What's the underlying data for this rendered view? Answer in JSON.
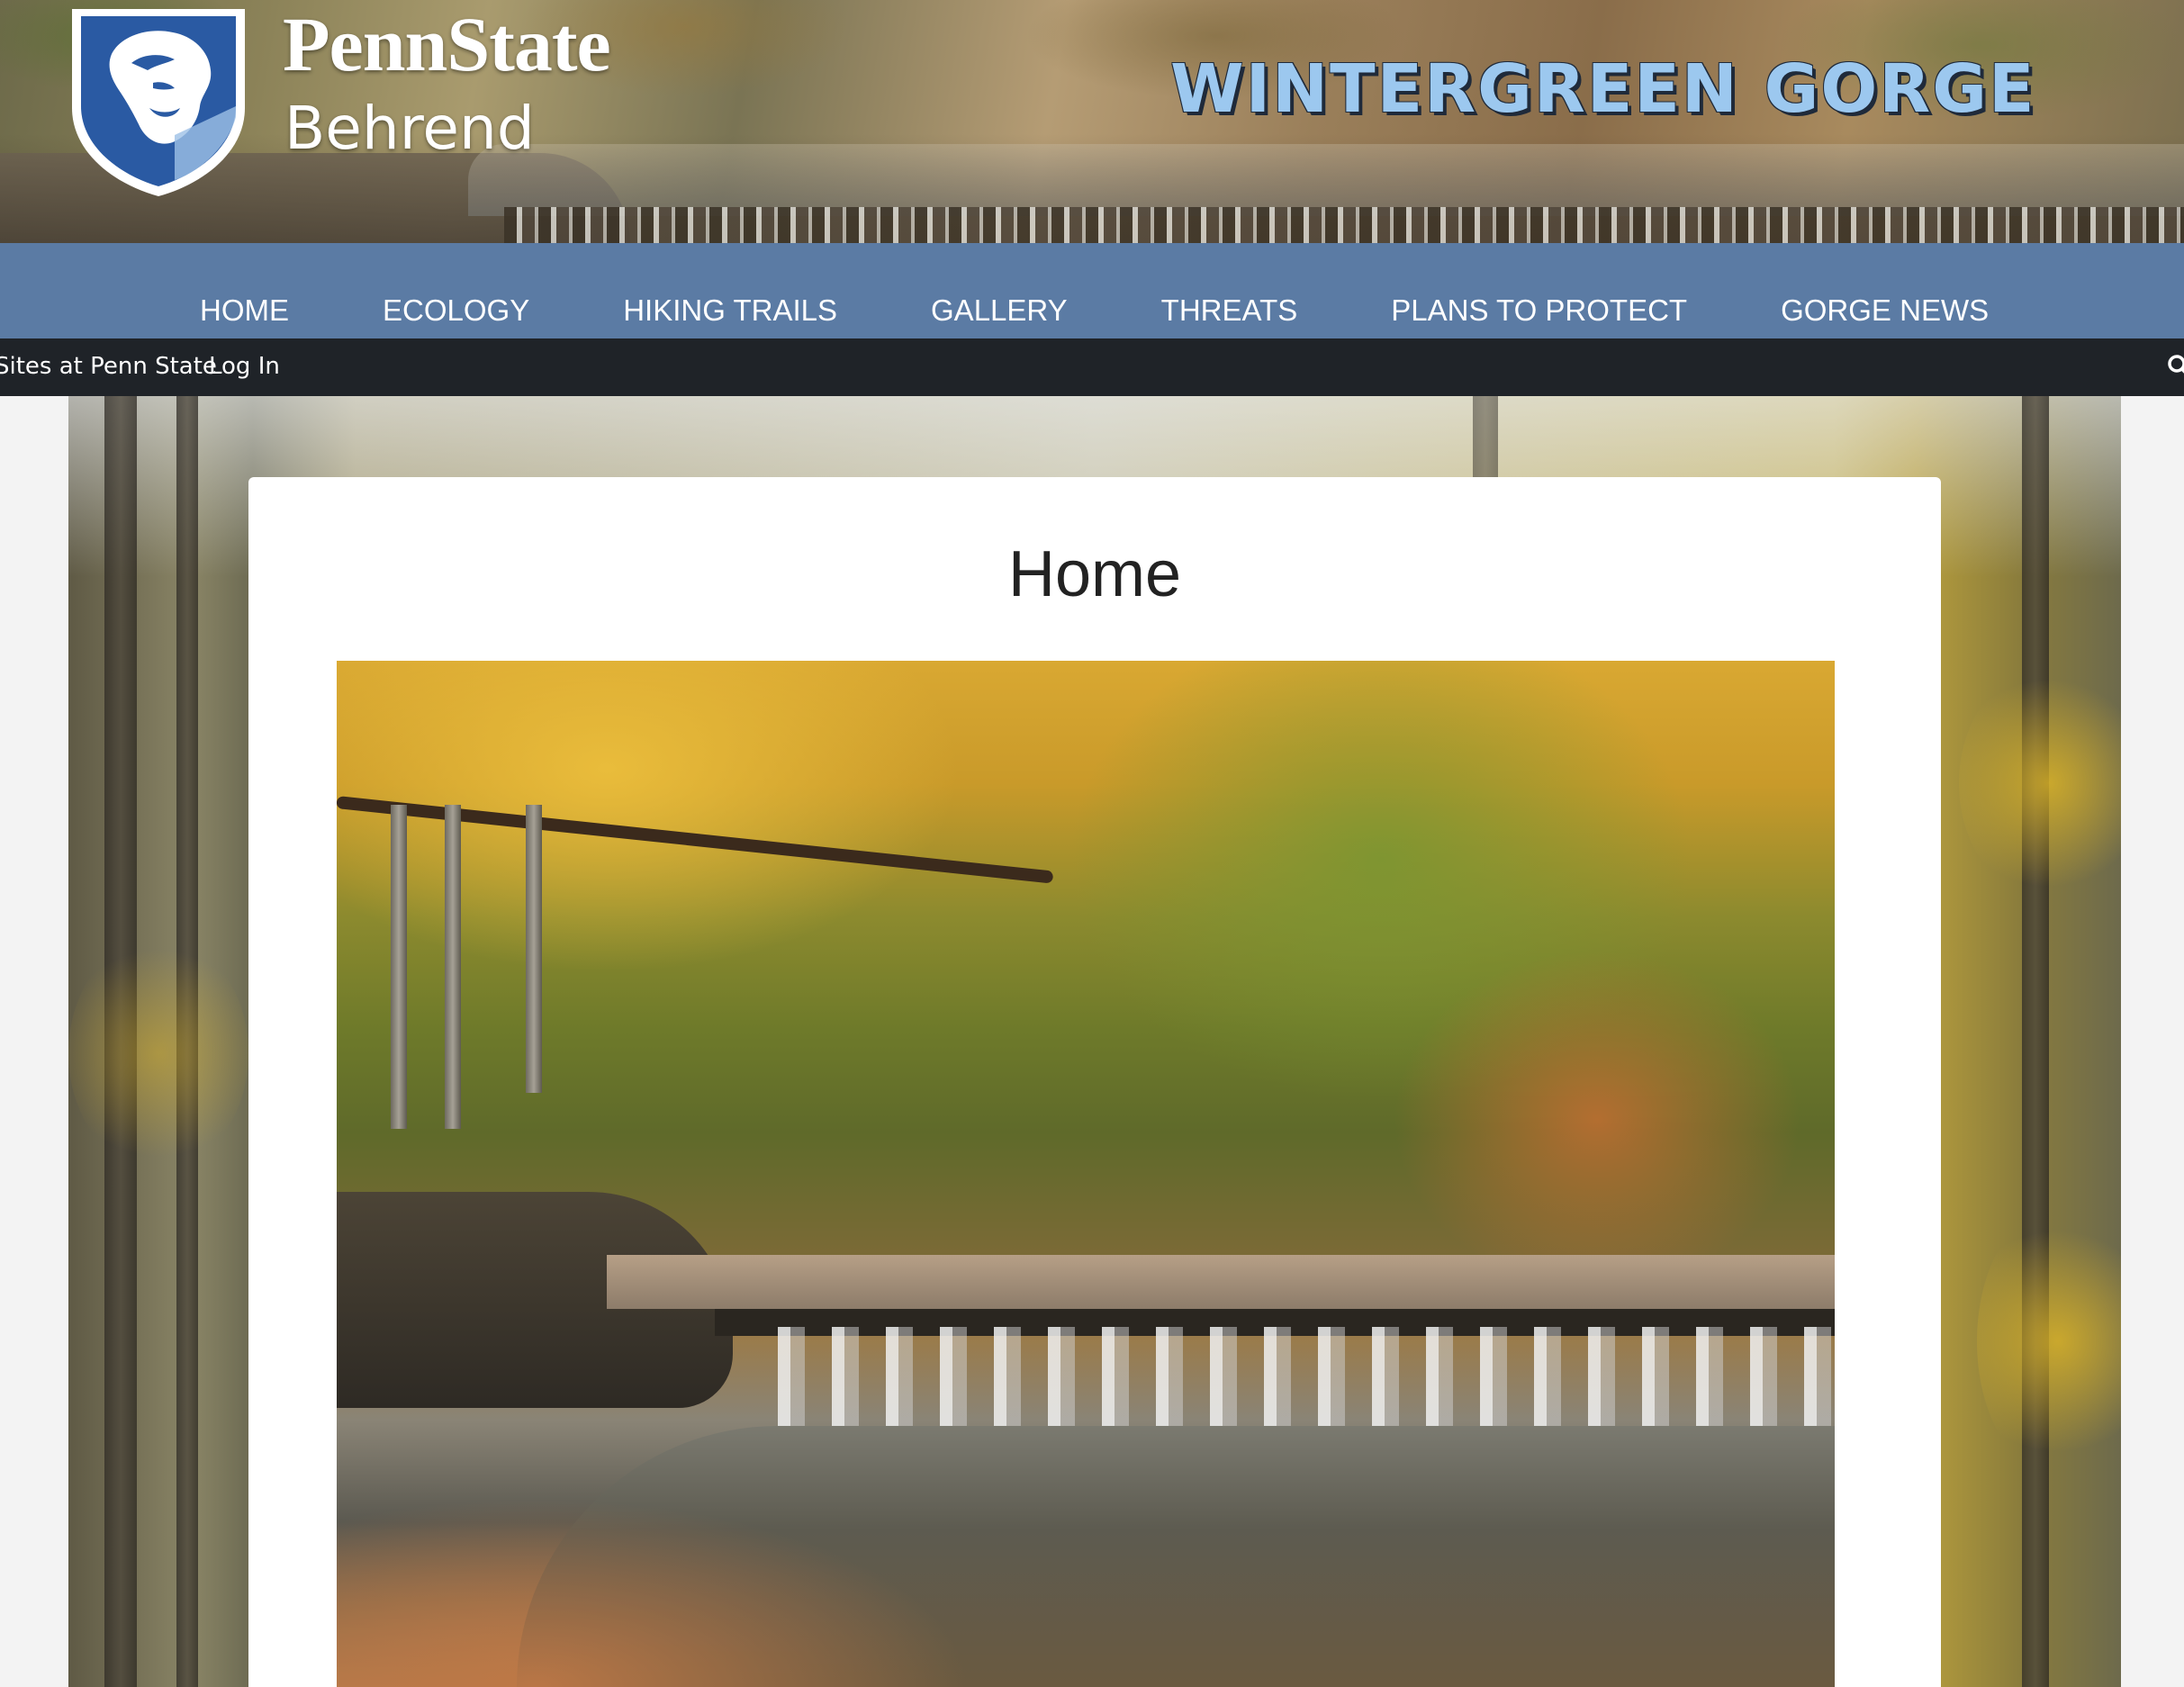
{
  "header": {
    "brand_name": "PennState",
    "brand_sub": "Behrend",
    "site_title": "WINTERGREEN GORGE"
  },
  "nav": {
    "items": [
      {
        "label": "HOME"
      },
      {
        "label": "ECOLOGY"
      },
      {
        "label": "HIKING TRAILS"
      },
      {
        "label": "GALLERY"
      },
      {
        "label": "THREATS"
      },
      {
        "label": "PLANS TO PROTECT"
      },
      {
        "label": "GORGE NEWS"
      }
    ]
  },
  "admin_bar": {
    "sites_label": "Sites at Penn State",
    "login_label": "Log In",
    "search_icon": "search-icon"
  },
  "main": {
    "page_title": "Home",
    "featured_image": "waterfall-creek-autumn-photo"
  },
  "colors": {
    "nav_bg": "#5b7ba4",
    "admin_bar_bg": "#1f2328",
    "title_text": "#9cc8ef",
    "shield_blue": "#2a5aa3"
  }
}
